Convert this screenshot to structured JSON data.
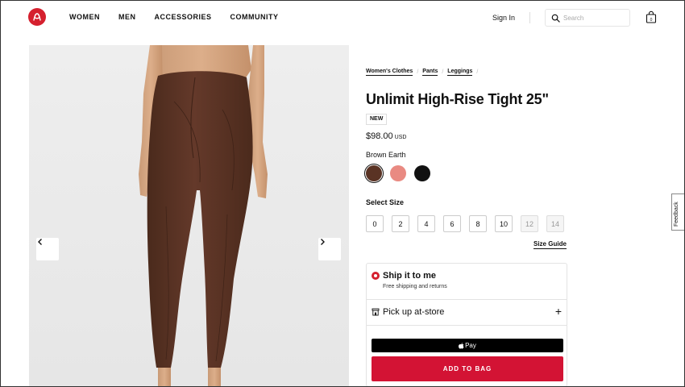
{
  "header": {
    "logo": "lululemon-logo",
    "nav": [
      "WOMEN",
      "MEN",
      "ACCESSORIES",
      "COMMUNITY"
    ],
    "sign_in": "Sign In",
    "search_placeholder": "Search",
    "bag_count": "0"
  },
  "breadcrumbs": [
    "Women's Clothes",
    "Pants",
    "Leggings"
  ],
  "product": {
    "title": "Unlimit High-Rise Tight 25\"",
    "badge": "NEW",
    "price": "$98.00",
    "currency": "USD",
    "color_name": "Brown Earth",
    "swatches": [
      {
        "name": "Brown Earth",
        "color": "#5a3324",
        "selected": true
      },
      {
        "name": "Pink",
        "color": "#e98a82",
        "selected": false
      },
      {
        "name": "Black",
        "color": "#111111",
        "selected": false
      }
    ],
    "size_label": "Select Size",
    "sizes": [
      {
        "label": "0",
        "available": true
      },
      {
        "label": "2",
        "available": true
      },
      {
        "label": "4",
        "available": true
      },
      {
        "label": "6",
        "available": true
      },
      {
        "label": "8",
        "available": true
      },
      {
        "label": "10",
        "available": true
      },
      {
        "label": "12",
        "available": false
      },
      {
        "label": "14",
        "available": false
      }
    ],
    "size_guide": "Size Guide"
  },
  "fulfillment": {
    "ship_title": "Ship it to me",
    "ship_subtitle": "Free shipping and returns",
    "pickup_title": "Pick up at-store",
    "apple_pay_label": "Pay",
    "add_to_bag": "ADD TO BAG"
  },
  "feedback": "Feedback",
  "colors": {
    "brand_red": "#d5202e",
    "add_to_bag_red": "#d31334",
    "legging_brown": "#5b3322"
  }
}
